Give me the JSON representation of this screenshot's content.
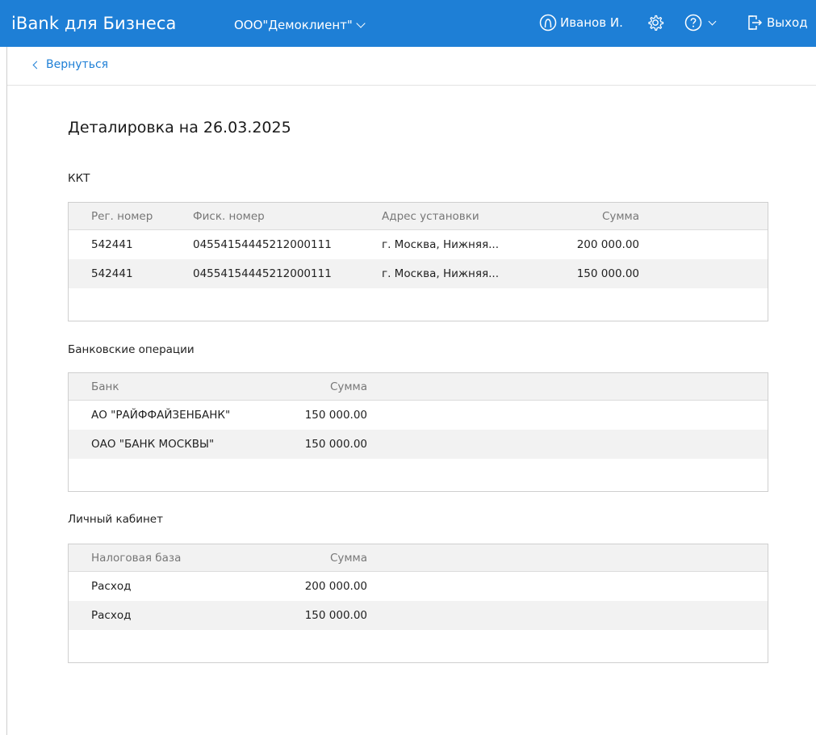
{
  "header": {
    "brand": "iBank для Бизнеса",
    "org": "ООО\"Демоклиент\"",
    "user": "Иванов И.",
    "logout": "Выход",
    "bg_color": "#1e7fd6"
  },
  "nav": {
    "back": "Вернуться"
  },
  "page": {
    "title": "Деталировка на 26.03.2025"
  },
  "kkt": {
    "label": "ККТ",
    "columns": [
      "Рег. номер",
      "Фиск. номер",
      "Адрес установки",
      "Сумма"
    ],
    "rows": [
      [
        "542441",
        "04554154445212000111",
        "г. Москва, Нижняя...",
        "200 000.00"
      ],
      [
        "542441",
        "04554154445212000111",
        "г. Москва, Нижняя...",
        "150 000.00"
      ]
    ]
  },
  "bank": {
    "label": "Банковские операции",
    "columns": [
      "Банк",
      "Сумма"
    ],
    "rows": [
      [
        "АО \"РАЙФФАЙЗЕНБАНК\"",
        "150 000.00"
      ],
      [
        "ОАО \"БАНК МОСКВЫ\"",
        "150 000.00"
      ]
    ]
  },
  "cabinet": {
    "label": "Личный кабинет",
    "columns": [
      "Налоговая база",
      "Сумма"
    ],
    "rows": [
      [
        "Расход",
        "200 000.00"
      ],
      [
        "Расход",
        "150 000.00"
      ]
    ]
  }
}
